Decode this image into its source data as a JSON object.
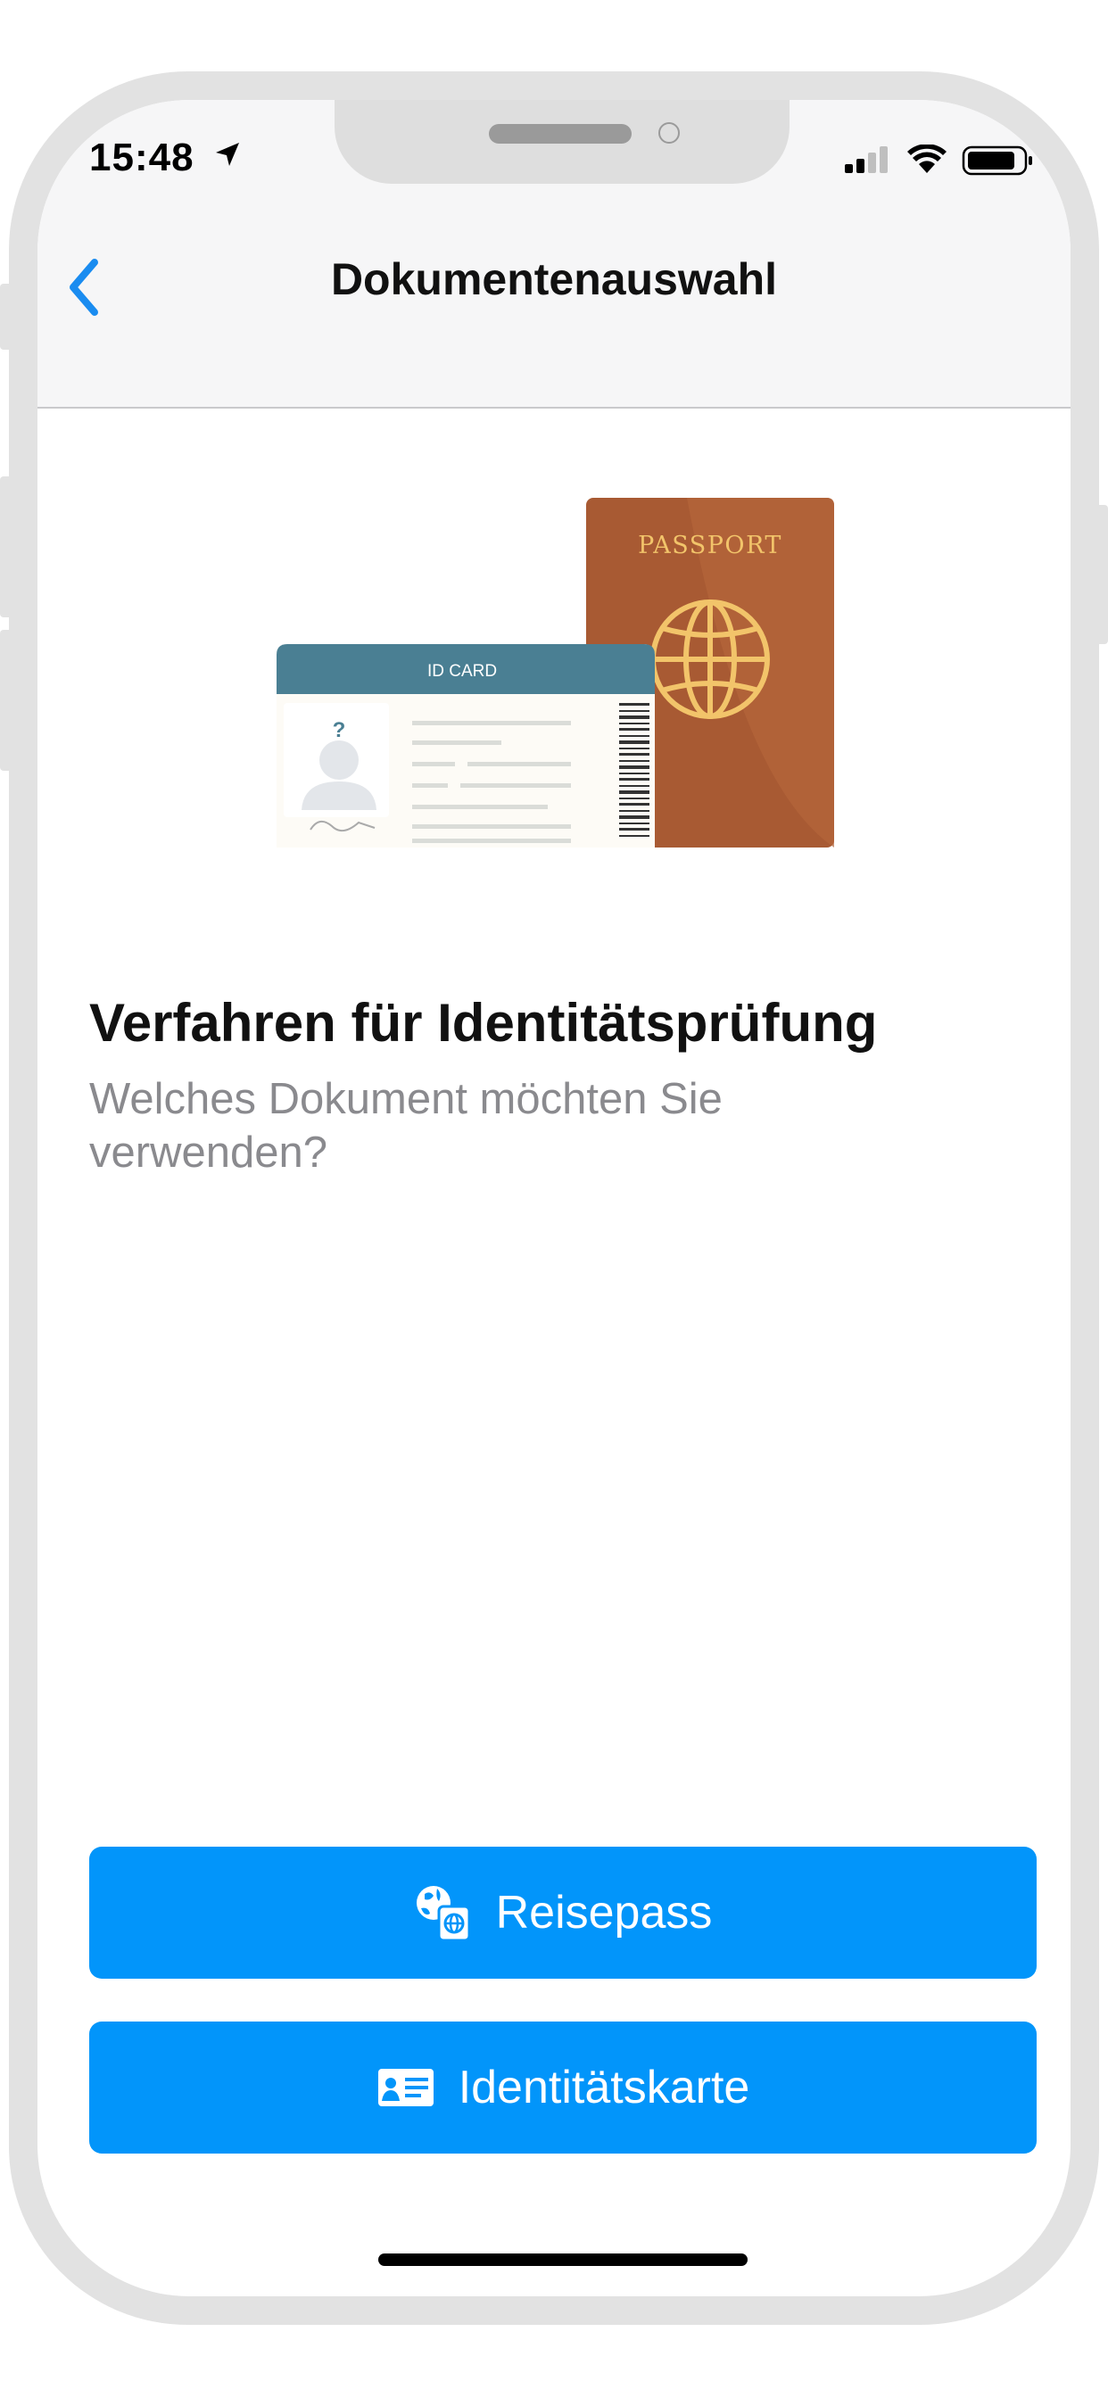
{
  "status_bar": {
    "time": "15:48"
  },
  "nav": {
    "title": "Dokumentenauswahl",
    "back_icon": "chevron-left-icon"
  },
  "illustration": {
    "id_card_label": "ID CARD",
    "id_card_photo_placeholder": "?",
    "passport_label": "PASSPORT"
  },
  "content": {
    "title": "Verfahren für Identitätsprüfung",
    "subtitle": "Welches Dokument möchten Sie verwenden?"
  },
  "buttons": {
    "passport": {
      "label": "Reisepass",
      "icon": "passport-icon"
    },
    "id_card": {
      "label": "Identitätskarte",
      "icon": "id-card-icon"
    }
  },
  "colors": {
    "accent": "#0295fa",
    "nav_back": "#1a8cf0",
    "passport_cover": "#a85a33",
    "passport_gold": "#f2c46a",
    "id_header": "#4a7f93"
  }
}
